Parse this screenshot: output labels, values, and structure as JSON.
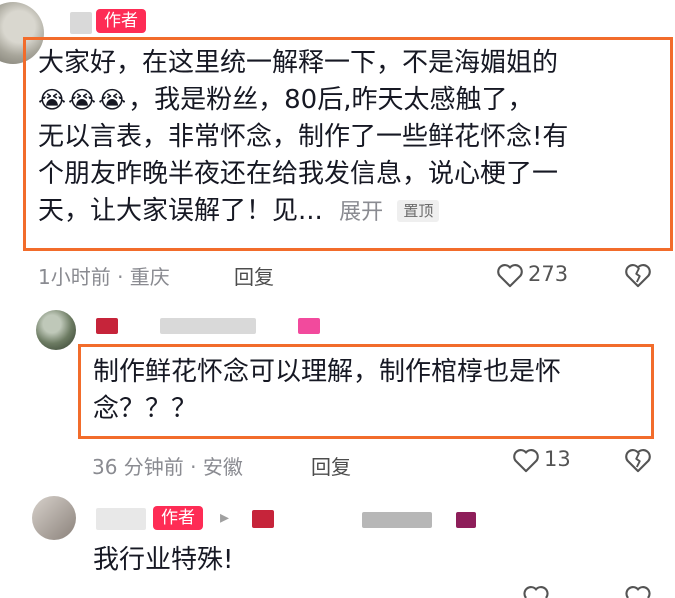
{
  "comments": [
    {
      "badge": "作者",
      "lines": [
        "大家好，在这里统一解释一下，不是海媚姐的",
        "，我是粉丝，80后,昨天太感触了，",
        "无以言表，非常怀念，制作了一些鲜花怀念!有",
        "个朋友昨晚半夜还在给我发信息，说心梗了一",
        "天，让大家误解了！见..."
      ],
      "emoji": "😭😭😭",
      "expand_label": "展开",
      "pin_label": "置顶",
      "time_location": "1小时前 · 重庆",
      "reply_label": "回复",
      "likes": "273"
    },
    {
      "lines": [
        "制作鲜花怀念可以理解，制作棺椁也是怀",
        "念？？？"
      ],
      "time_location": "36 分钟前 · 安徽",
      "reply_label": "回复",
      "likes": "13"
    },
    {
      "badge": "作者",
      "arrow": "▸",
      "text": "我行业特殊!"
    }
  ],
  "colors": {
    "author_badge": "#fe2c55",
    "highlight_border": "#f26c2b",
    "meta_text": "#8a8b91"
  }
}
